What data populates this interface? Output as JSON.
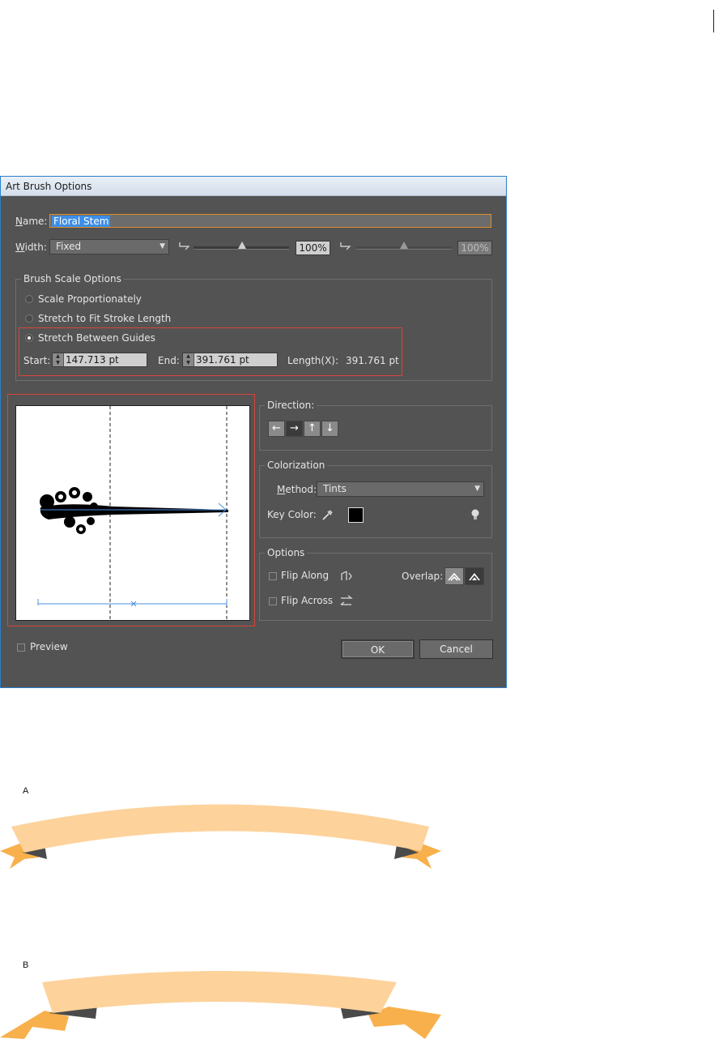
{
  "dialog": {
    "title": "Art Brush Options",
    "name_label": "Name:",
    "name_value": "Floral Stem",
    "width_label": "Width:",
    "width_value": "Fixed",
    "width_pct_1": "100%",
    "width_pct_2": "100%",
    "brush_scale": {
      "legend": "Brush Scale Options",
      "options": [
        "Scale Proportionately",
        "Stretch to Fit Stroke Length",
        "Stretch Between Guides"
      ],
      "selected": "Stretch Between Guides",
      "start_label": "Start:",
      "start_value": "147.713 pt",
      "end_label": "End:",
      "end_value": "391.761 pt",
      "length_label": "Length(X):",
      "length_value": "391.761 pt"
    },
    "direction": {
      "legend": "Direction:",
      "buttons": [
        "←",
        "→",
        "↑",
        "↓"
      ],
      "selected": "→"
    },
    "colorization": {
      "legend": "Colorization",
      "method_label": "Method:",
      "method_value": "Tints",
      "key_color_label": "Key Color:",
      "key_color": "#000000"
    },
    "options": {
      "legend": "Options",
      "flip_along": "Flip Along",
      "flip_across": "Flip Across",
      "overlap_label": "Overlap:"
    },
    "preview_label": "Preview",
    "ok_label": "OK",
    "cancel_label": "Cancel"
  },
  "figures": {
    "a_label": "A",
    "b_label": "B",
    "ribbon_color": "#fdd29b",
    "tail_color": "#f8b04c",
    "fold_color": "#4a4a4a"
  }
}
